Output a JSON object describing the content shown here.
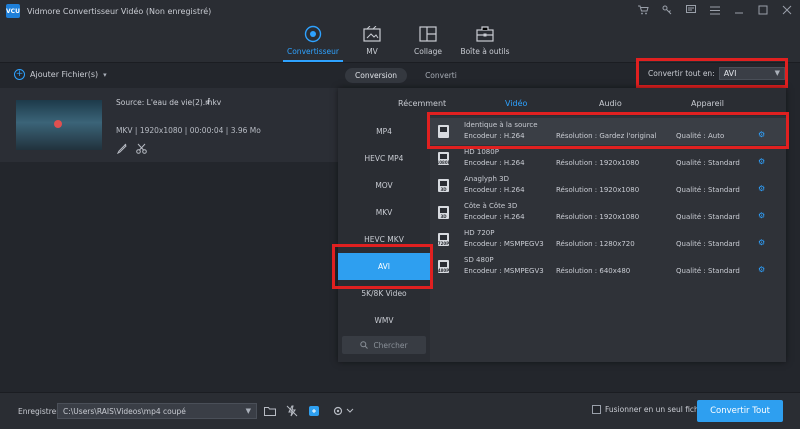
{
  "window": {
    "logo_text": "VCU",
    "title": "Vidmore Convertisseur Vidéo (Non enregistré)"
  },
  "toolbar": {
    "tools": [
      {
        "label": "Convertisseur",
        "icon": "convert-icon",
        "active": true
      },
      {
        "label": "MV",
        "icon": "mv-icon",
        "active": false
      },
      {
        "label": "Collage",
        "icon": "collage-icon",
        "active": false
      },
      {
        "label": "Boîte à outils",
        "icon": "toolbox-icon",
        "active": false
      }
    ]
  },
  "subbar": {
    "add_files": "Ajouter Fichier(s)",
    "tab_converting": "Conversion",
    "tab_converted": "Converti",
    "convert_all_label": "Convertir tout en:",
    "convert_all_value": "AVI"
  },
  "file": {
    "source": "Source: L'eau de vie(2).mkv",
    "meta": "MKV | 1920x1080 | 00:00:04 | 3.96 Mo"
  },
  "panel": {
    "tabs": [
      "Récemment",
      "Vidéo",
      "Audio",
      "Appareil"
    ],
    "active_tab": "Vidéo",
    "formats": [
      "MP4",
      "HEVC MP4",
      "MOV",
      "MKV",
      "HEVC MKV",
      "AVI",
      "5K/8K Video",
      "WMV"
    ],
    "selected_format": "AVI",
    "search_placeholder": "Chercher",
    "presets": [
      {
        "name": "Identique à la source",
        "encoder": "Encodeur : H.264",
        "resolution": "Résolution : Gardez l'original",
        "quality": "Qualité : Auto",
        "badge": ""
      },
      {
        "name": "HD 1080P",
        "encoder": "Encodeur : H.264",
        "resolution": "Résolution : 1920x1080",
        "quality": "Qualité : Standard",
        "badge": "1080P"
      },
      {
        "name": "Anaglyph 3D",
        "encoder": "Encodeur : H.264",
        "resolution": "Résolution : 1920x1080",
        "quality": "Qualité : Standard",
        "badge": "3D"
      },
      {
        "name": "Côte à Côte 3D",
        "encoder": "Encodeur : H.264",
        "resolution": "Résolution : 1920x1080",
        "quality": "Qualité : Standard",
        "badge": "3D"
      },
      {
        "name": "HD 720P",
        "encoder": "Encodeur : MSMPEGV3",
        "resolution": "Résolution : 1280x720",
        "quality": "Qualité : Standard",
        "badge": "720P"
      },
      {
        "name": "SD 480P",
        "encoder": "Encodeur : MSMPEGV3",
        "resolution": "Résolution : 640x480",
        "quality": "Qualité : Standard",
        "badge": "480P"
      }
    ]
  },
  "bottom": {
    "save_label": "Enregistrer:",
    "save_path": "C:\\Users\\RAIS\\Videos\\mp4 coupé",
    "merge_label": "Fusionner en un seul fichier",
    "convert_button": "Convertir Tout"
  },
  "colors": {
    "accent": "#2ea2ff",
    "highlight_box": "#e02020",
    "background": "#23262c"
  }
}
